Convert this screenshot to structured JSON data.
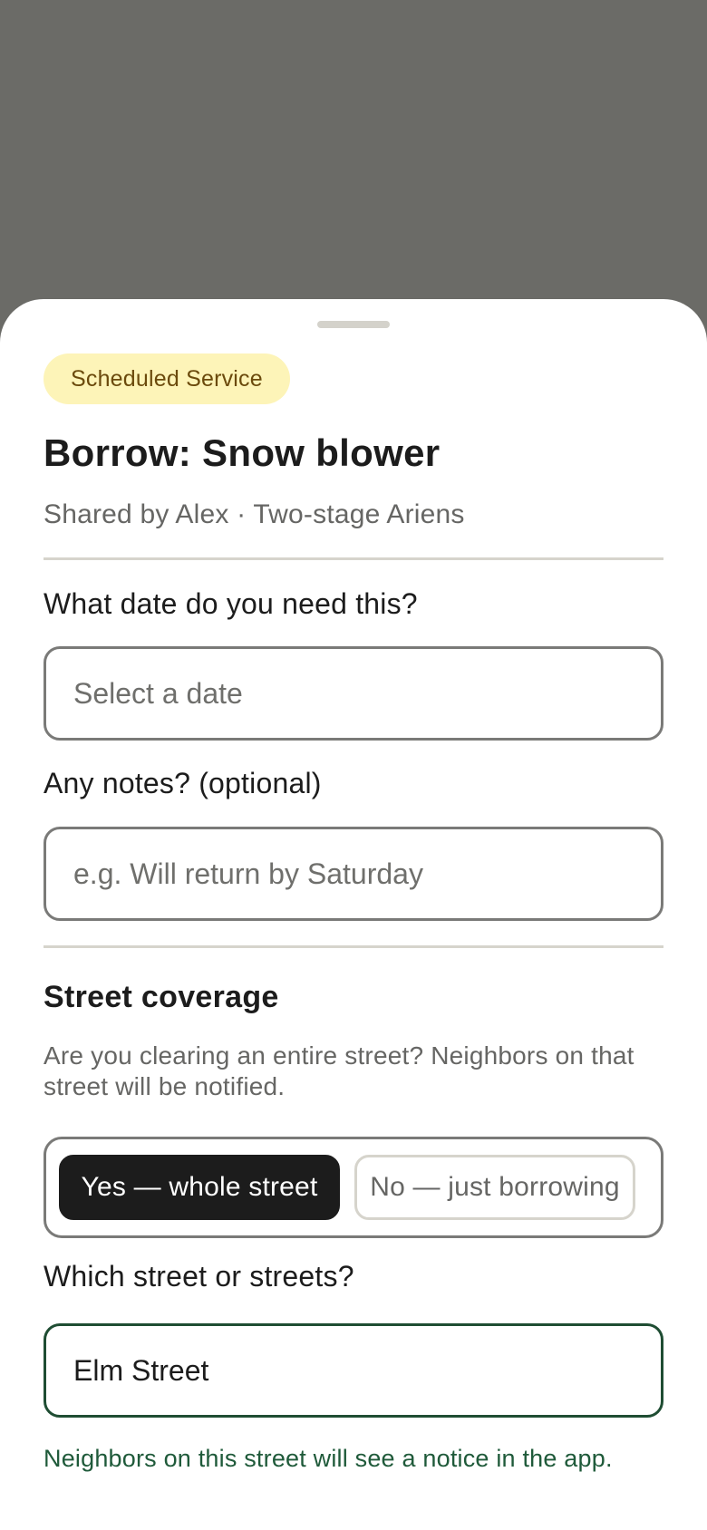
{
  "badge": {
    "label": "Scheduled Service"
  },
  "header": {
    "title": "Borrow: Snow blower",
    "subtitle": "Shared by Alex · Two-stage Ariens"
  },
  "date_field": {
    "label": "What date do you need this?",
    "placeholder": "Select a date",
    "value": ""
  },
  "notes_field": {
    "label": "Any notes?  (optional)",
    "placeholder": "e.g. Will return by Saturday",
    "value": ""
  },
  "street_coverage": {
    "heading": "Street coverage",
    "description": "Are you clearing an entire street? Neighbors on that street will be notified.",
    "options": [
      {
        "label": "Yes — whole street",
        "selected": true
      },
      {
        "label": "No — just borrowing",
        "selected": false
      }
    ]
  },
  "street_field": {
    "label": "Which street or streets?",
    "value": "Elm Street",
    "help_text": "Neighbors on this street will see a notice in the app."
  },
  "colors": {
    "backdrop": "#6b6b67",
    "badge_bg": "#fdf4b8",
    "accent_green": "#1f4d33",
    "selected_toggle": "#1c1c1c"
  }
}
